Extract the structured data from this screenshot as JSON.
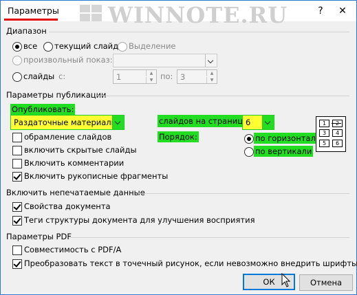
{
  "window": {
    "title": "Параметры",
    "help": "?",
    "close": "✕"
  },
  "watermark": "WINNOTE.RU",
  "range": {
    "group_label": "Диапазон",
    "all": "все",
    "current_slide": "текущий слайд",
    "selection": "Выделение",
    "custom_show": "произвольный показ:",
    "slides": "слайды",
    "from_label": "с:",
    "from_value": "1",
    "to_label": "по:",
    "to_value": "3"
  },
  "publish": {
    "group_label": "Параметры публикации",
    "publish_what_label": "Опубликовать:",
    "publish_what_value": "Раздаточные материалы",
    "slides_per_page_label": "слайдов на странице:",
    "slides_per_page_value": "6",
    "order_label": "Порядок:",
    "order_horizontal": "по горизонтали",
    "order_vertical": "по вертикали",
    "frame_slides": "обрамление слайдов",
    "include_hidden": "включить скрытые слайды",
    "include_comments": "Включить комментарии",
    "include_ink": "Включить рукописные фрагменты",
    "layout_numbers": [
      "1",
      "2",
      "3",
      "4",
      "5",
      "6"
    ]
  },
  "nonprint": {
    "group_label": "Включить непечатаемые данные",
    "doc_props": "Свойства документа",
    "struct_tags": "Теги структуры документа для улучшения восприятия"
  },
  "pdf": {
    "group_label": "Параметры PDF",
    "pdfa": "Совместимость с PDF/A",
    "bitmap": "Преобразовать текст в точечный рисунок, если невозможно внедрить шрифты"
  },
  "buttons": {
    "ok": "ОК",
    "cancel": "Отмена"
  }
}
